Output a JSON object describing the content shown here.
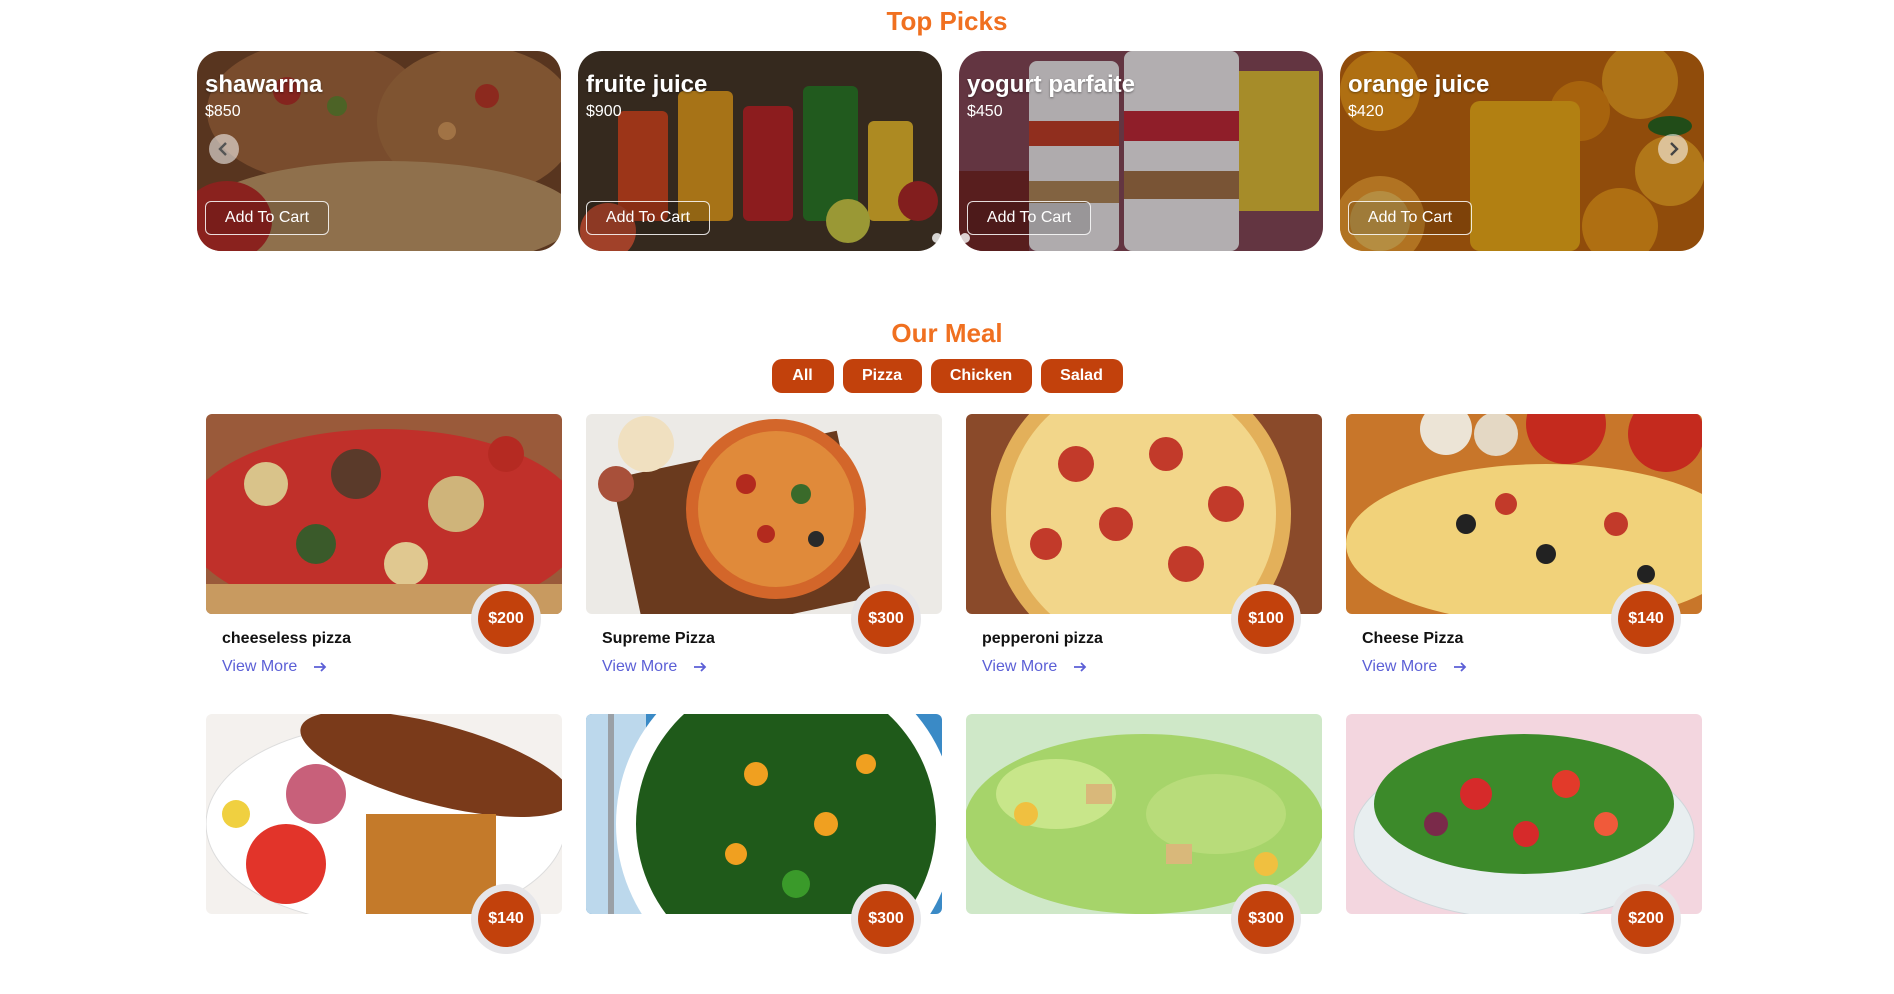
{
  "top_picks": {
    "title": "Top Picks",
    "items": [
      {
        "name": "shawarma",
        "price": "$850",
        "button": "Add To Cart"
      },
      {
        "name": "fruite juice",
        "price": "$900",
        "button": "Add To Cart"
      },
      {
        "name": "yogurt parfaite",
        "price": "$450",
        "button": "Add To Cart"
      },
      {
        "name": "orange juice",
        "price": "$420",
        "button": "Add To Cart"
      }
    ],
    "prev_icon": "chevron-left-icon",
    "next_icon": "chevron-right-icon"
  },
  "our_meal": {
    "title": "Our Meal",
    "filters": [
      "All",
      "Pizza",
      "Chicken",
      "Salad"
    ],
    "items": [
      {
        "name": "cheeseless pizza",
        "price": "$200",
        "link": "View More"
      },
      {
        "name": "Supreme Pizza",
        "price": "$300",
        "link": "View More"
      },
      {
        "name": "pepperoni pizza",
        "price": "$100",
        "link": "View More"
      },
      {
        "name": "Cheese Pizza",
        "price": "$140",
        "link": "View More"
      },
      {
        "name": "",
        "price": "$140",
        "link": ""
      },
      {
        "name": "",
        "price": "$300",
        "link": ""
      },
      {
        "name": "",
        "price": "$300",
        "link": ""
      },
      {
        "name": "",
        "price": "$200",
        "link": ""
      }
    ]
  },
  "colors": {
    "accent": "#f07020",
    "button": "#c2410c",
    "link": "#5b5fd6"
  }
}
